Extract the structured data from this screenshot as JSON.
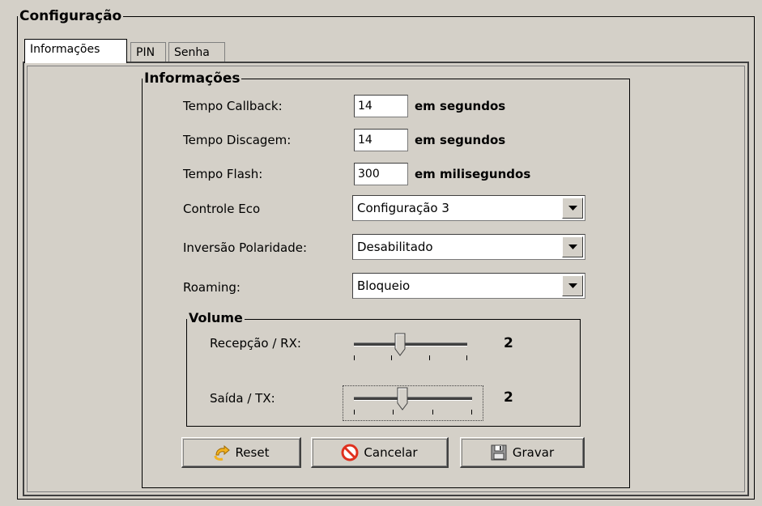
{
  "outer_group": {
    "title": "Configuração"
  },
  "tabs": [
    {
      "label": "Informações",
      "active": true
    },
    {
      "label": "PIN",
      "active": false
    },
    {
      "label": "Senha",
      "active": false
    }
  ],
  "info_group": {
    "title": "Informações",
    "fields": [
      {
        "label": "Tempo Callback:",
        "value": "14",
        "unit": "em segundos"
      },
      {
        "label": "Tempo Discagem:",
        "value": "14",
        "unit": "em segundos"
      },
      {
        "label": "Tempo Flash:",
        "value": "300",
        "unit": "em milisegundos"
      }
    ],
    "combos": [
      {
        "label": "Controle Eco",
        "value": "Configuração 3"
      },
      {
        "label": "Inversão Polaridade:",
        "value": "Desabilitado"
      },
      {
        "label": "Roaming:",
        "value": "Bloqueio"
      }
    ]
  },
  "volume_group": {
    "title": "Volume",
    "sliders": [
      {
        "label": "Recepção / RX:",
        "value": "2",
        "level": 2,
        "max": 5
      },
      {
        "label": "Saída / TX:",
        "value": "2",
        "level": 2,
        "max": 5
      }
    ]
  },
  "buttons": {
    "reset": "Reset",
    "cancel": "Cancelar",
    "save": "Gravar"
  },
  "icons": {
    "reset": "reset-arrow-icon",
    "cancel": "cancel-icon",
    "save": "floppy-disk-icon",
    "dropdown": "chevron-down-icon"
  },
  "colors": {
    "background": "#d4d0c8",
    "cancel_red": "#e0301e",
    "reset_yellow": "#f2b21f"
  }
}
